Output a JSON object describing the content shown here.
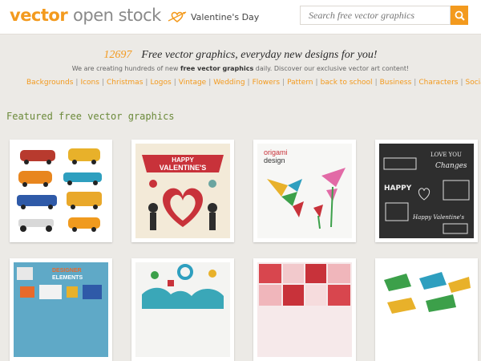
{
  "header": {
    "logo_part1": "vector",
    "logo_part2": "open stock",
    "promo_label": "Valentine's Day",
    "search_placeholder": "Search free vector graphics"
  },
  "intro": {
    "count": "12697",
    "headline": "Free vector graphics, everyday new designs for you!",
    "sub_prefix": "We are creating hundreds of new",
    "sub_bold": "free vector graphics",
    "sub_suffix": "daily. Discover our exclusive vector art content!"
  },
  "categories": [
    "Backgrounds",
    "Icons",
    "Christmas",
    "Logos",
    "Vintage",
    "Wedding",
    "Flowers",
    "Pattern",
    "back to school",
    "Business",
    "Characters",
    "Social Media Icons"
  ],
  "section_title": "Featured free vector graphics",
  "thumbs": {
    "t2_text1": "HAPPY",
    "t2_text2": "VALENTINE'S",
    "t3_title1": "origami",
    "t3_title2": "design",
    "t4_text1": "LOVE YOU",
    "t4_text2": "Changes",
    "t4_text3": "HAPPY",
    "t4_text4": "Happy Valentine's",
    "t5_title1": "DESIGNER",
    "t5_title2": "ELEMENTS"
  },
  "colors": {
    "accent": "#f39a1e",
    "featured_green": "#6b8a3a"
  }
}
